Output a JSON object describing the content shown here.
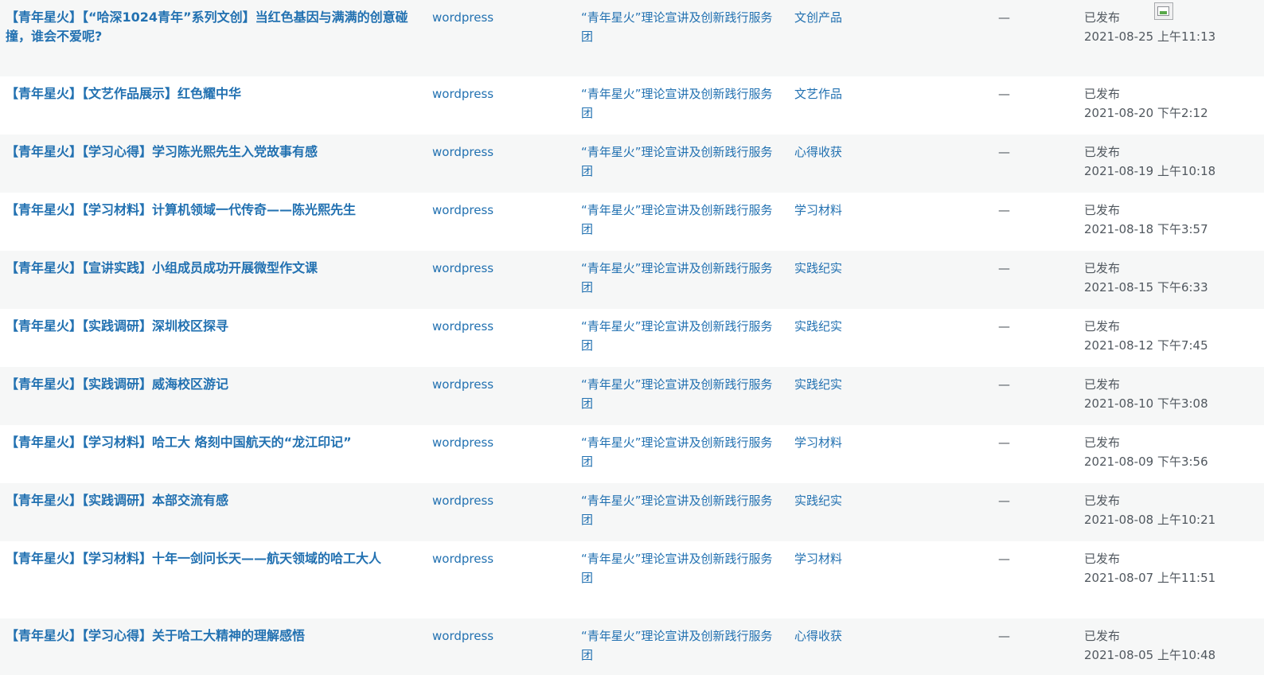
{
  "rows": [
    {
      "title": "【青年星火】【“哈深1024青年”系列文创】当红色基因与满满的创意碰撞，谁会不爱呢?",
      "author": "wordpress",
      "tag": "“青年星火”理论宣讲及创新践行服务团",
      "category": "文创产品",
      "comments": "—",
      "status": "已发布",
      "date": "2021-08-25 上午11:13",
      "broken_thumbnail": "broken-image-icon"
    },
    {
      "title": "【青年星火】【文艺作品展示】红色耀中华",
      "author": "wordpress",
      "tag": "“青年星火”理论宣讲及创新践行服务团",
      "category": "文艺作品",
      "comments": "—",
      "status": "已发布",
      "date": "2021-08-20 下午2:12"
    },
    {
      "title": "【青年星火】【学习心得】学习陈光熙先生入党故事有感",
      "author": "wordpress",
      "tag": "“青年星火”理论宣讲及创新践行服务团",
      "category": "心得收获",
      "comments": "—",
      "status": "已发布",
      "date": "2021-08-19 上午10:18"
    },
    {
      "title": "【青年星火】【学习材料】计算机领域一代传奇——陈光熙先生",
      "author": "wordpress",
      "tag": "“青年星火”理论宣讲及创新践行服务团",
      "category": "学习材料",
      "comments": "—",
      "status": "已发布",
      "date": "2021-08-18 下午3:57"
    },
    {
      "title": "【青年星火】【宣讲实践】小组成员成功开展微型作文课",
      "author": "wordpress",
      "tag": "“青年星火”理论宣讲及创新践行服务团",
      "category": "实践纪实",
      "comments": "—",
      "status": "已发布",
      "date": "2021-08-15 下午6:33"
    },
    {
      "title": "【青年星火】【实践调研】深圳校区探寻",
      "author": "wordpress",
      "tag": "“青年星火”理论宣讲及创新践行服务团",
      "category": "实践纪实",
      "comments": "—",
      "status": "已发布",
      "date": "2021-08-12 下午7:45"
    },
    {
      "title": "【青年星火】【实践调研】威海校区游记",
      "author": "wordpress",
      "tag": "“青年星火”理论宣讲及创新践行服务团",
      "category": "实践纪实",
      "comments": "—",
      "status": "已发布",
      "date": "2021-08-10 下午3:08"
    },
    {
      "title": "【青年星火】【学习材料】哈工大 烙刻中国航天的“龙江印记”",
      "author": "wordpress",
      "tag": "“青年星火”理论宣讲及创新践行服务团",
      "category": "学习材料",
      "comments": "—",
      "status": "已发布",
      "date": "2021-08-09 下午3:56"
    },
    {
      "title": "【青年星火】【实践调研】本部交流有感",
      "author": "wordpress",
      "tag": "“青年星火”理论宣讲及创新践行服务团",
      "category": "实践纪实",
      "comments": "—",
      "status": "已发布",
      "date": "2021-08-08 上午10:21"
    },
    {
      "title": "【青年星火】【学习材料】十年一剑问长天——航天领域的哈工大人",
      "author": "wordpress",
      "tag": "“青年星火”理论宣讲及创新践行服务团",
      "category": "学习材料",
      "comments": "—",
      "status": "已发布",
      "date": "2021-08-07 上午11:51"
    },
    {
      "title": "【青年星火】【学习心得】关于哈工大精神的理解感悟",
      "author": "wordpress",
      "tag": "“青年星火”理论宣讲及创新践行服务团",
      "category": "心得收获",
      "comments": "—",
      "status": "已发布",
      "date": "2021-08-05 上午10:48"
    }
  ],
  "colors": {
    "link": "#2271b1",
    "text": "#50575e",
    "row_alt": "#f6f7f7",
    "row_plain": "#ffffff"
  }
}
